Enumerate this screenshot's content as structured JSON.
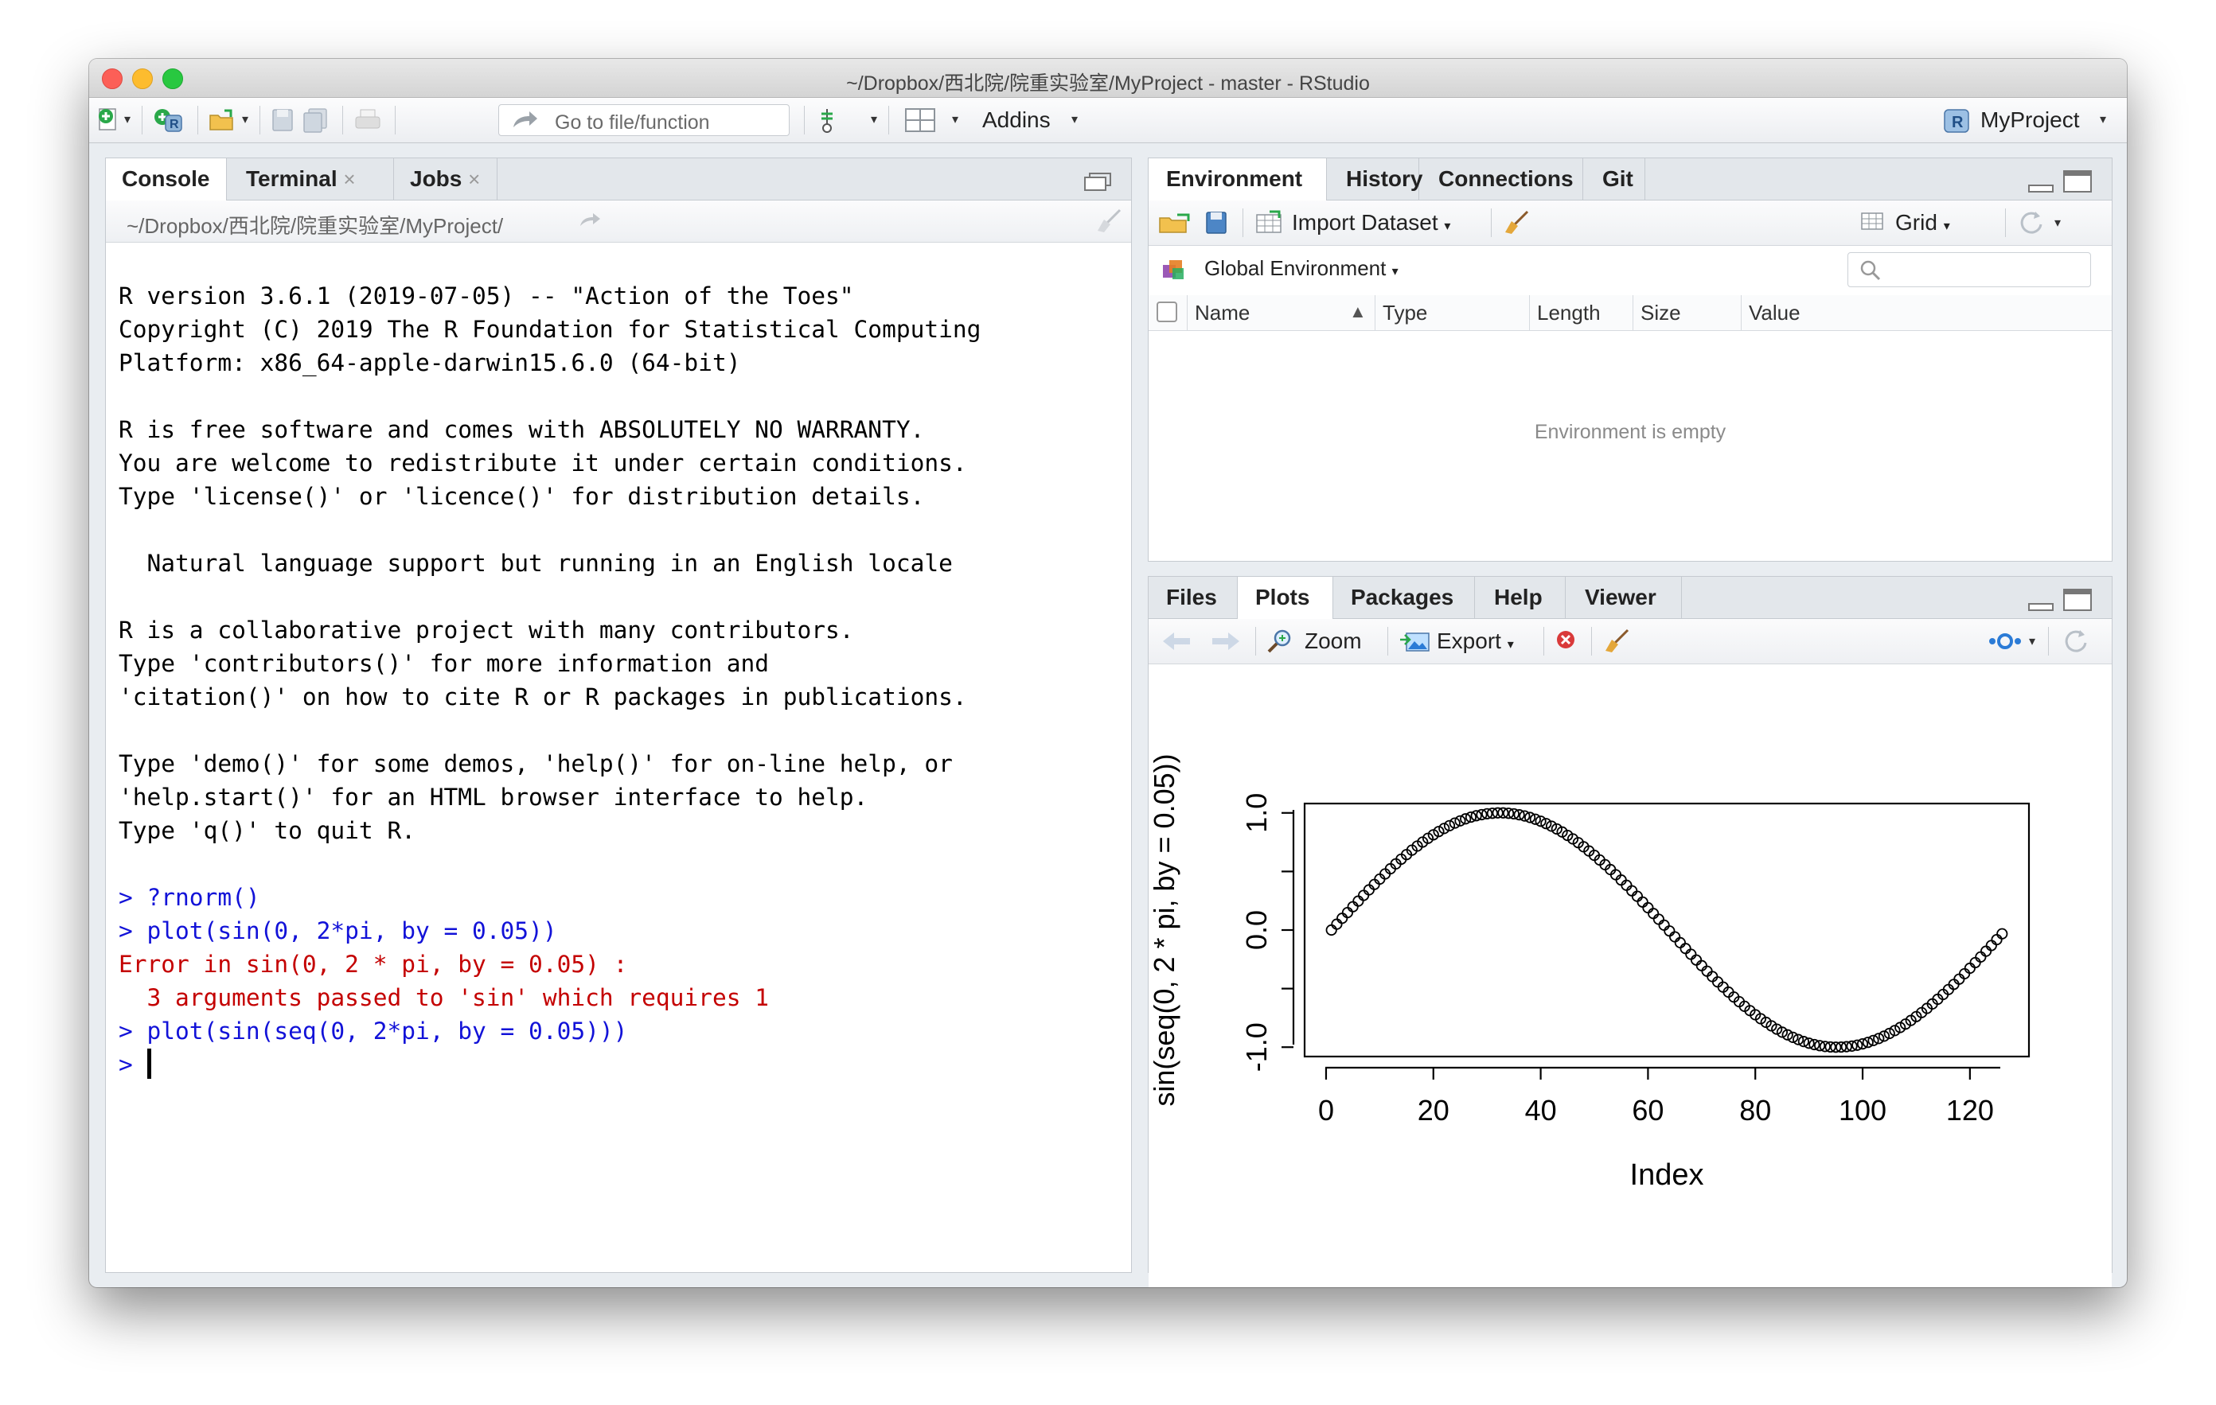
{
  "window": {
    "title": "~/Dropbox/西北院/院重实验室/MyProject - master - RStudio"
  },
  "toolbar": {
    "goto_placeholder": "Go to file/function",
    "addins_label": "Addins",
    "project_label": "MyProject"
  },
  "console_pane": {
    "tabs": [
      {
        "label": "Console",
        "closable": false
      },
      {
        "label": "Terminal",
        "closable": true,
        "close": "×"
      },
      {
        "label": "Jobs",
        "closable": true,
        "close": "×"
      }
    ],
    "path": "~/Dropbox/西北院/院重实验室/MyProject/",
    "lines": [
      {
        "text": "R version 3.6.1 (2019-07-05) -- \"Action of the Toes\"",
        "kind": "output"
      },
      {
        "text": "Copyright (C) 2019 The R Foundation for Statistical Computing",
        "kind": "output"
      },
      {
        "text": "Platform: x86_64-apple-darwin15.6.0 (64-bit)",
        "kind": "output"
      },
      {
        "text": "",
        "kind": "output"
      },
      {
        "text": "R is free software and comes with ABSOLUTELY NO WARRANTY.",
        "kind": "output"
      },
      {
        "text": "You are welcome to redistribute it under certain conditions.",
        "kind": "output"
      },
      {
        "text": "Type 'license()' or 'licence()' for distribution details.",
        "kind": "output"
      },
      {
        "text": "",
        "kind": "output"
      },
      {
        "text": "  Natural language support but running in an English locale",
        "kind": "output"
      },
      {
        "text": "",
        "kind": "output"
      },
      {
        "text": "R is a collaborative project with many contributors.",
        "kind": "output"
      },
      {
        "text": "Type 'contributors()' for more information and",
        "kind": "output"
      },
      {
        "text": "'citation()' on how to cite R or R packages in publications.",
        "kind": "output"
      },
      {
        "text": "",
        "kind": "output"
      },
      {
        "text": "Type 'demo()' for some demos, 'help()' for on-line help, or",
        "kind": "output"
      },
      {
        "text": "'help.start()' for an HTML browser interface to help.",
        "kind": "output"
      },
      {
        "text": "Type 'q()' to quit R.",
        "kind": "output"
      },
      {
        "text": "",
        "kind": "output"
      },
      {
        "text": "> ?rnorm()",
        "kind": "input"
      },
      {
        "text": "> plot(sin(0, 2*pi, by = 0.05))",
        "kind": "input"
      },
      {
        "text": "Error in sin(0, 2 * pi, by = 0.05) :",
        "kind": "error"
      },
      {
        "text": "  3 arguments passed to 'sin' which requires 1",
        "kind": "error"
      },
      {
        "text": "> plot(sin(seq(0, 2*pi, by = 0.05)))",
        "kind": "input"
      }
    ],
    "prompt": "> "
  },
  "env_pane": {
    "tabs": [
      "Environment",
      "History",
      "Connections",
      "Git"
    ],
    "import_label": "Import Dataset",
    "grid_label": "Grid",
    "scope_label": "Global Environment",
    "columns": [
      "Name",
      "Type",
      "Length",
      "Size",
      "Value"
    ],
    "empty_message": "Environment is empty"
  },
  "plots_pane": {
    "tabs": [
      "Files",
      "Plots",
      "Packages",
      "Help",
      "Viewer"
    ],
    "zoom_label": "Zoom",
    "export_label": "Export"
  },
  "chart_data": {
    "type": "scatter",
    "title": "",
    "xlabel": "Index",
    "ylabel": "sin(seq(0, 2 * pi, by = 0.05))",
    "generator": "y = sin(seq(0, 2*pi, by = 0.05)), x = index 1..126",
    "n_points": 126,
    "x": [
      1,
      2,
      3,
      4,
      5,
      6,
      7,
      8,
      9,
      10,
      11,
      12,
      13,
      14,
      15,
      16,
      17,
      18,
      19,
      20,
      21,
      22,
      23,
      24,
      25,
      26,
      27,
      28,
      29,
      30,
      31,
      32,
      33,
      34,
      35,
      36,
      37,
      38,
      39,
      40,
      41,
      42,
      43,
      44,
      45,
      46,
      47,
      48,
      49,
      50,
      51,
      52,
      53,
      54,
      55,
      56,
      57,
      58,
      59,
      60,
      61,
      62,
      63,
      64,
      65,
      66,
      67,
      68,
      69,
      70,
      71,
      72,
      73,
      74,
      75,
      76,
      77,
      78,
      79,
      80,
      81,
      82,
      83,
      84,
      85,
      86,
      87,
      88,
      89,
      90,
      91,
      92,
      93,
      94,
      95,
      96,
      97,
      98,
      99,
      100,
      101,
      102,
      103,
      104,
      105,
      106,
      107,
      108,
      109,
      110,
      111,
      112,
      113,
      114,
      115,
      116,
      117,
      118,
      119,
      120,
      121,
      122,
      123,
      124,
      125,
      126
    ],
    "y": [
      0.0,
      0.05,
      0.1,
      0.149,
      0.199,
      0.247,
      0.296,
      0.343,
      0.389,
      0.435,
      0.479,
      0.523,
      0.565,
      0.605,
      0.644,
      0.682,
      0.717,
      0.751,
      0.783,
      0.813,
      0.841,
      0.867,
      0.891,
      0.913,
      0.932,
      0.949,
      0.964,
      0.976,
      0.985,
      0.993,
      0.997,
      1.0,
      1.0,
      0.997,
      0.992,
      0.984,
      0.974,
      0.961,
      0.946,
      0.929,
      0.909,
      0.887,
      0.863,
      0.837,
      0.808,
      0.778,
      0.746,
      0.711,
      0.675,
      0.638,
      0.598,
      0.558,
      0.516,
      0.472,
      0.427,
      0.382,
      0.335,
      0.288,
      0.239,
      0.19,
      0.141,
      0.092,
      0.042,
      -0.008,
      -0.058,
      -0.108,
      -0.158,
      -0.207,
      -0.256,
      -0.304,
      -0.351,
      -0.397,
      -0.443,
      -0.487,
      -0.53,
      -0.572,
      -0.612,
      -0.651,
      -0.688,
      -0.723,
      -0.757,
      -0.788,
      -0.818,
      -0.846,
      -0.872,
      -0.895,
      -0.916,
      -0.935,
      -0.952,
      -0.966,
      -0.978,
      -0.987,
      -0.994,
      -0.998,
      -1.0,
      -0.999,
      -0.996,
      -0.991,
      -0.983,
      -0.972,
      -0.959,
      -0.943,
      -0.926,
      -0.906,
      -0.883,
      -0.858,
      -0.832,
      -0.803,
      -0.772,
      -0.739,
      -0.705,
      -0.669,
      -0.631,
      -0.591,
      -0.55,
      -0.508,
      -0.464,
      -0.419,
      -0.373,
      -0.326,
      -0.278,
      -0.23,
      -0.181,
      -0.132,
      -0.082,
      -0.032
    ],
    "xticks": [
      0,
      20,
      40,
      60,
      80,
      100,
      120
    ],
    "yticks": [
      -1.0,
      0.0,
      1.0
    ],
    "ytick_labels": [
      "-1.0",
      "0.0",
      "1.0"
    ],
    "xlim": [
      -4,
      131
    ],
    "ylim": [
      -1.08,
      1.08
    ],
    "marker": "open-circle",
    "grid": false,
    "legend": "none"
  },
  "colors": {
    "console_input": "#1212d8",
    "console_error": "#c40000",
    "pane_border": "#c5cad0",
    "tab_strip": "#e3e7eb"
  }
}
